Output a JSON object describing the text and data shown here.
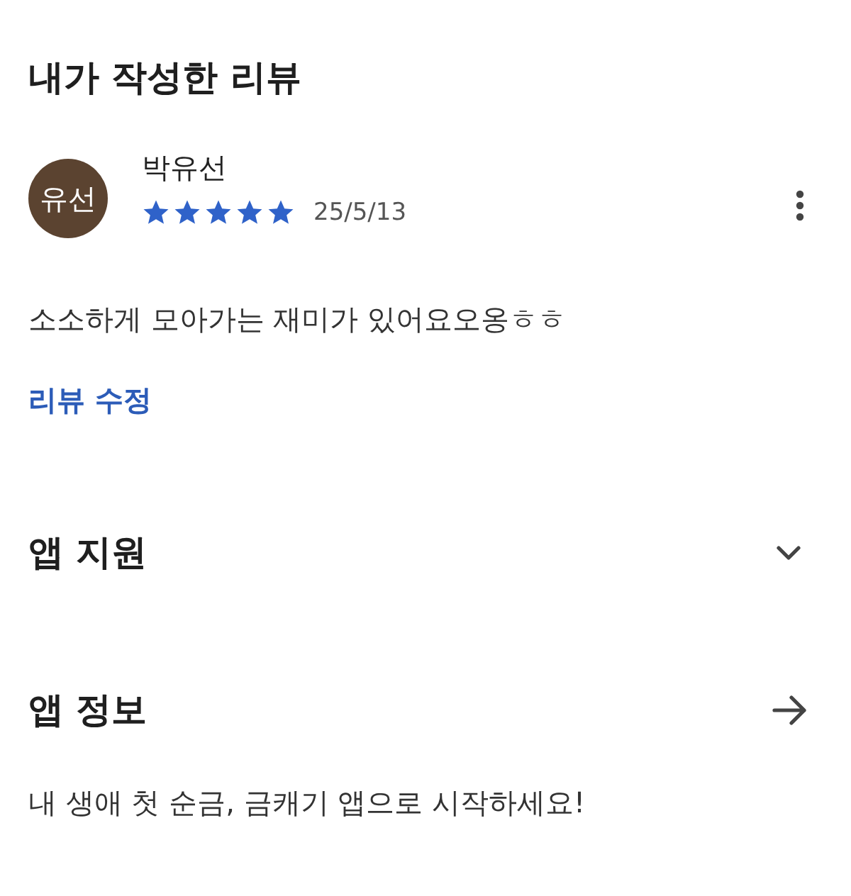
{
  "header": {
    "title": "내가 작성한 리뷰"
  },
  "review": {
    "avatar_text": "유선",
    "author": "박유선",
    "stars": 5,
    "date": "25/5/13",
    "body": "소소하게 모아가는 재미가 있어요오옹ㅎㅎ",
    "edit_link": "리뷰 수정"
  },
  "sections": [
    {
      "kind": "expand",
      "title": "앱 지원",
      "expanded": false
    },
    {
      "kind": "link",
      "title": "앱 정보",
      "description": "내 생애 첫 순금, 금캐기 앱으로 시작하세요!"
    }
  ]
}
